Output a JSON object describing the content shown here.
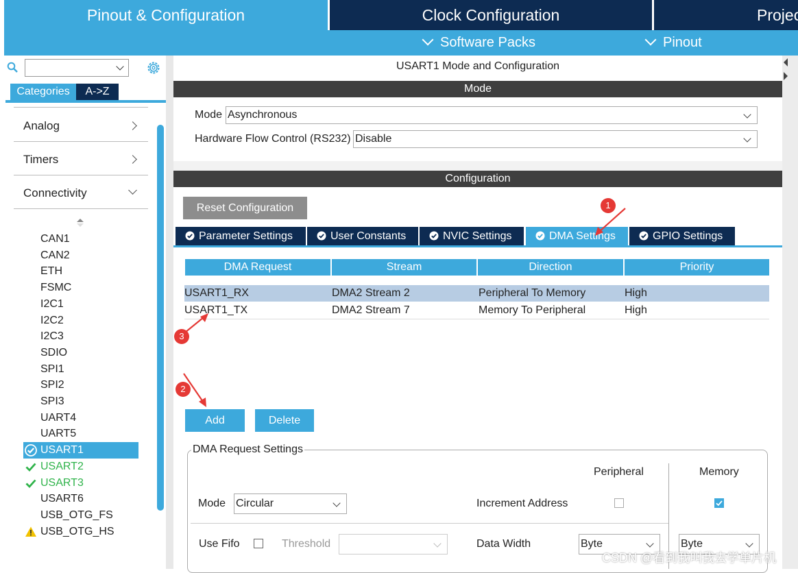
{
  "topnav": {
    "pinout": "Pinout & Configuration",
    "clock": "Clock Configuration",
    "project": "Project Manager"
  },
  "subnav": {
    "software_packs": "Software Packs",
    "pinout": "Pinout"
  },
  "sidebar": {
    "search": {
      "value": ""
    },
    "tabs": {
      "categories": "Categories",
      "az": "A->Z"
    },
    "categories": [
      {
        "label": "Analog"
      },
      {
        "label": "Timers"
      },
      {
        "label": "Connectivity"
      }
    ],
    "peripherals": [
      {
        "label": "CAN1",
        "state": "none"
      },
      {
        "label": "CAN2",
        "state": "none"
      },
      {
        "label": "ETH",
        "state": "none"
      },
      {
        "label": "FSMC",
        "state": "none"
      },
      {
        "label": "I2C1",
        "state": "none"
      },
      {
        "label": "I2C2",
        "state": "none"
      },
      {
        "label": "I2C3",
        "state": "none"
      },
      {
        "label": "SDIO",
        "state": "none"
      },
      {
        "label": "SPI1",
        "state": "none"
      },
      {
        "label": "SPI2",
        "state": "none"
      },
      {
        "label": "SPI3",
        "state": "none"
      },
      {
        "label": "UART4",
        "state": "none"
      },
      {
        "label": "UART5",
        "state": "none"
      },
      {
        "label": "USART1",
        "state": "selected"
      },
      {
        "label": "USART2",
        "state": "ok"
      },
      {
        "label": "USART3",
        "state": "ok"
      },
      {
        "label": "USART6",
        "state": "none"
      },
      {
        "label": "USB_OTG_FS",
        "state": "none"
      },
      {
        "label": "USB_OTG_HS",
        "state": "warning"
      }
    ]
  },
  "main": {
    "title": "USART1 Mode and Configuration",
    "mode_band": "Mode",
    "mode_label": "Mode",
    "mode_value": "Asynchronous",
    "hwfc_label": "Hardware Flow Control (RS232)",
    "hwfc_value": "Disable",
    "config_band": "Configuration",
    "reset_label": "Reset Configuration",
    "tabs": [
      {
        "label": "Parameter Settings"
      },
      {
        "label": "User Constants"
      },
      {
        "label": "NVIC Settings"
      },
      {
        "label": "DMA Settings"
      },
      {
        "label": "GPIO Settings"
      }
    ],
    "dma_table": {
      "headers": [
        "DMA Request",
        "Stream",
        "Direction",
        "Priority"
      ],
      "rows": [
        [
          "USART1_RX",
          "DMA2 Stream 2",
          "Peripheral To Memory",
          "High"
        ],
        [
          "USART1_TX",
          "DMA2 Stream 7",
          "Memory To Peripheral",
          "High"
        ]
      ]
    },
    "add_label": "Add",
    "delete_label": "Delete",
    "request_settings": {
      "legend": "DMA Request Settings",
      "peripheral_col": "Peripheral",
      "memory_col": "Memory",
      "mode_label": "Mode",
      "mode_value": "Circular",
      "increment_label": "Increment Address",
      "use_fifo_label": "Use Fifo",
      "threshold_label": "Threshold",
      "threshold_value": "",
      "data_width_label": "Data Width",
      "periph_width": "Byte",
      "mem_width": "Byte",
      "periph_increment": false,
      "mem_increment": true,
      "use_fifo": false
    }
  },
  "annotations": [
    "1",
    "2",
    "3"
  ],
  "watermark": "CSDN @看到我叫我去学单片机"
}
